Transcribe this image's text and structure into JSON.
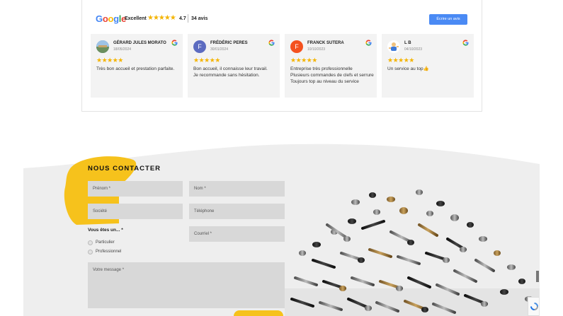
{
  "reviews": {
    "brand": "Google",
    "summary_label": "Excellent",
    "stars": "★★★★★",
    "rating": "4.7",
    "count": "34 avis",
    "write_button": "Écrire un avis",
    "items": [
      {
        "name": "GÉRARD JULES MORATO",
        "date": "18/05/2024",
        "stars": "★★★★★",
        "text": "Très bon accueil et prestation parfaite.",
        "avatar_initial": "",
        "avatar_color": "#7fa6c9"
      },
      {
        "name": "FRÉDÉRIC PERES",
        "date": "30/01/2024",
        "stars": "★★★★★",
        "text": "Bon accueil, il connaisse leur travail.\nJe recommande sans hésitation.",
        "avatar_initial": "F",
        "avatar_color": "#5c6bc0"
      },
      {
        "name": "FRANCK SUTERA",
        "date": "10/10/2023",
        "stars": "★★★★★",
        "text": "Entreprise très professionnelle\nPlusieurs commandes de clefs et serrure\nToujours top au niveau du service",
        "avatar_initial": "F",
        "avatar_color": "#f4511e"
      },
      {
        "name": "L B",
        "date": "04/10/2023",
        "stars": "★★★★★",
        "text": "Un service au top👍",
        "avatar_initial": "",
        "avatar_color": "#8fbce8"
      }
    ]
  },
  "contact": {
    "title": "NOUS CONTACTER",
    "fields": {
      "prenom": "Prénom *",
      "nom": "Nom *",
      "societe": "Société",
      "telephone": "Téléphone",
      "courriel": "Courriel *",
      "message": "Votre message *"
    },
    "choice_label": "Vous êtes un... *",
    "options": [
      "Particulier",
      "Professionnel"
    ]
  },
  "colors": {
    "accent_yellow": "#f6c21c",
    "google_blue": "#4a8af4",
    "star": "#f4b400"
  }
}
